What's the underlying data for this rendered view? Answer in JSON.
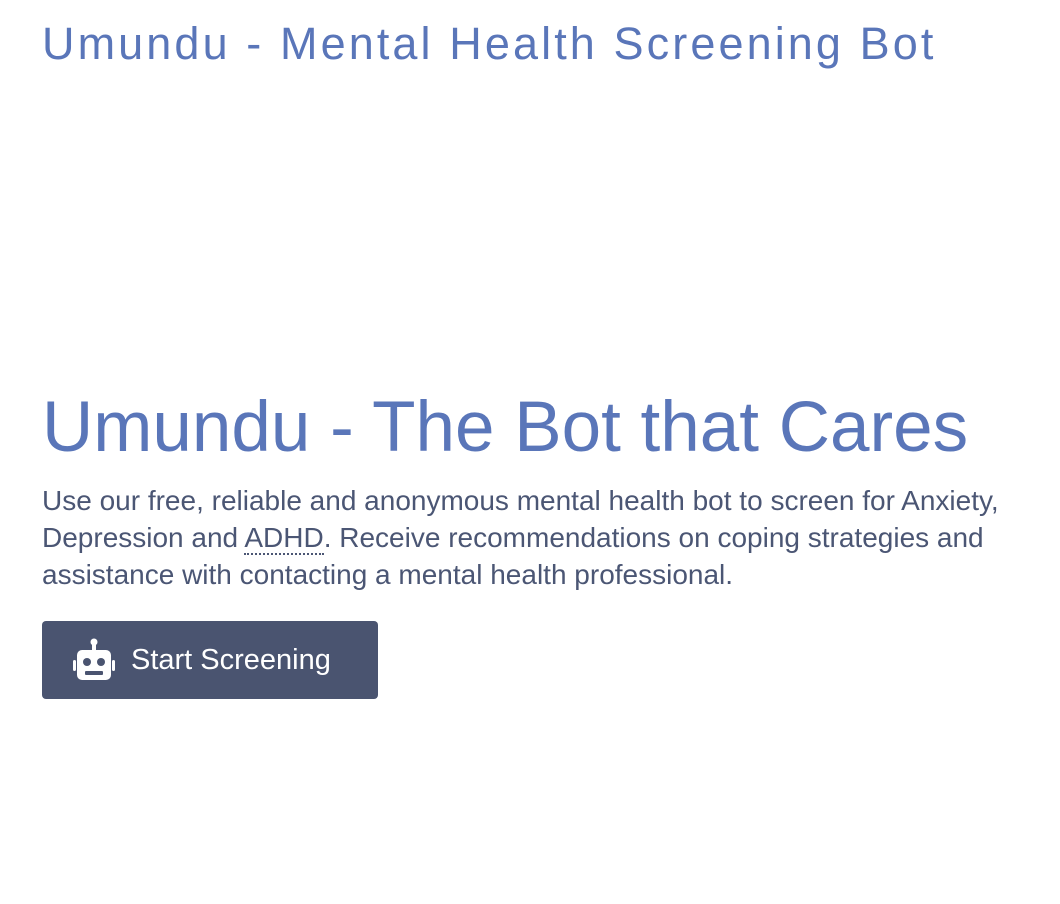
{
  "header": {
    "title": "Umundu - Mental Health Screening Bot"
  },
  "hero": {
    "title": "Umundu - The Bot that Cares",
    "text_before": "Use our free, reliable and anonymous mental health bot to screen for Anxiety, Depression and ",
    "abbr": "ADHD",
    "text_after": ". Receive recommendations on coping strategies and assistance with contacting a mental health professional.",
    "button_label": "Start Screening",
    "button_icon": "robot-icon"
  },
  "colors": {
    "accent": "#5a76b9",
    "body_text": "#4b5674",
    "button_bg": "#4a5470"
  }
}
